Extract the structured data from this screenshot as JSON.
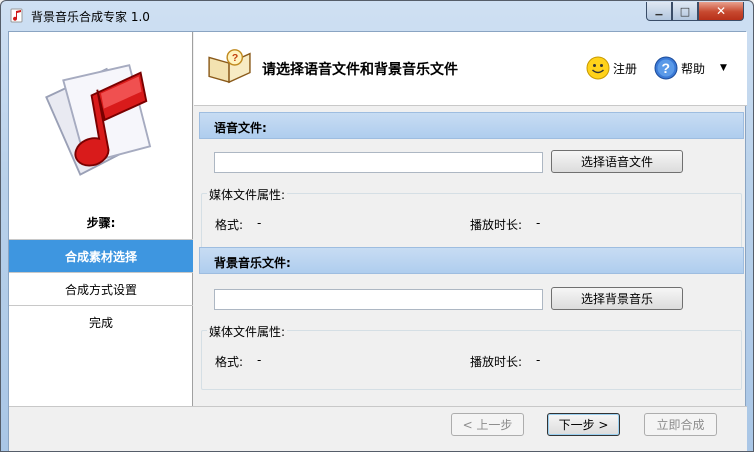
{
  "window": {
    "title": "背景音乐合成专家 1.0",
    "controls": {
      "minimize": "▁",
      "maximize": "□",
      "close": "✕"
    }
  },
  "sidebar": {
    "steps_label": "步骤:",
    "steps": [
      {
        "label": "合成素材选择",
        "active": true
      },
      {
        "label": "合成方式设置",
        "active": false
      },
      {
        "label": "完成",
        "active": false
      }
    ]
  },
  "header": {
    "title": "请选择语音文件和背景音乐文件",
    "register_label": "注册",
    "help_label": "帮助"
  },
  "voice": {
    "section_title": "语音文件:",
    "path_value": "",
    "choose_button": "选择语音文件",
    "props_legend": "媒体文件属性:",
    "format_label": "格式:",
    "format_value": "-",
    "duration_label": "播放时长:",
    "duration_value": "-"
  },
  "music": {
    "section_title": "背景音乐文件:",
    "path_value": "",
    "choose_button": "选择背景音乐",
    "props_legend": "媒体文件属性:",
    "format_label": "格式:",
    "format_value": "-",
    "duration_label": "播放时长:",
    "duration_value": "-"
  },
  "footer": {
    "prev_button": "< 上一步",
    "next_button": "下一步 >",
    "compose_button": "立即合成"
  },
  "colors": {
    "active_step": "#3e96e0",
    "section_bar": "#c7dcf3"
  },
  "icons": {
    "app": "music-note-icon",
    "header": "open-book-icon",
    "register": "smiley-icon",
    "help": "question-icon"
  }
}
